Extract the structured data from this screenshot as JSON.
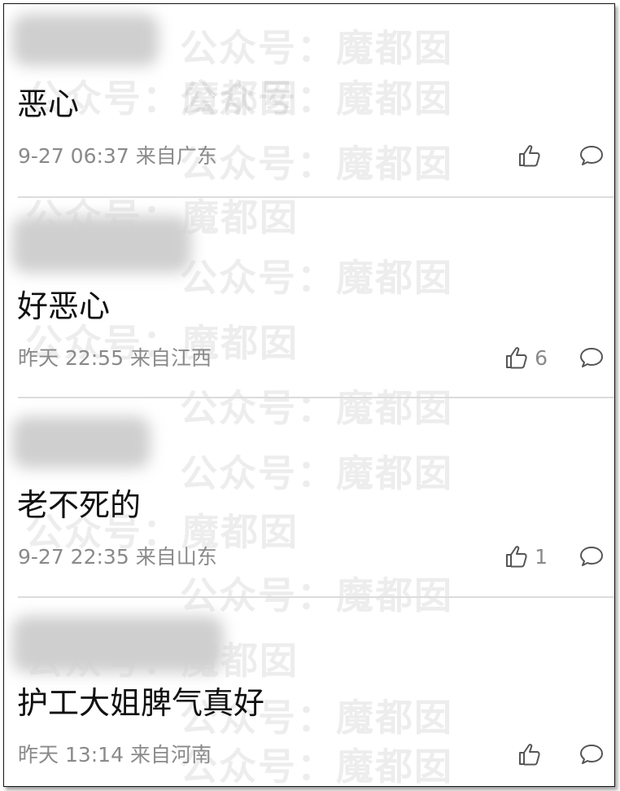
{
  "watermark": "公众号：魔都囡",
  "comments": [
    {
      "text": "恶心",
      "time": "9-27 06:37",
      "location": "来自广东",
      "likes": ""
    },
    {
      "text": "好恶心",
      "time": "昨天 22:55",
      "location": "来自江西",
      "likes": "6"
    },
    {
      "text": "老不死的",
      "time": "9-27 22:35",
      "location": "来自山东",
      "likes": "1"
    },
    {
      "text": "护工大姐脾气真好",
      "time": "昨天 13:14",
      "location": "来自河南",
      "likes": ""
    }
  ],
  "icons": {
    "like": "thumbs-up-icon",
    "reply": "speech-bubble-icon"
  },
  "colors": {
    "text": "#111111",
    "meta": "#8a8a8a",
    "divider": "#dcdcdc"
  }
}
